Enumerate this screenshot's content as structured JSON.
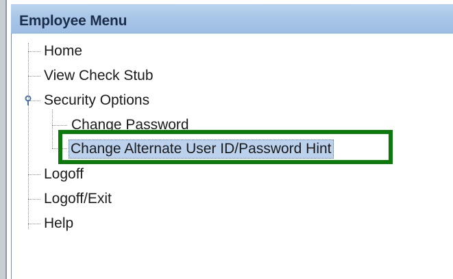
{
  "window": {
    "title": "Employee Menu"
  },
  "tree": {
    "items": [
      {
        "label": "Home"
      },
      {
        "label": "View Check Stub"
      },
      {
        "label": "Security Options",
        "expanded": true,
        "children": [
          {
            "label": "Change Password"
          },
          {
            "label": "Change Alternate User ID/Password Hint",
            "selected": true
          }
        ]
      },
      {
        "label": "Logoff"
      },
      {
        "label": "Logoff/Exit"
      },
      {
        "label": "Help"
      }
    ]
  },
  "colors": {
    "title_bar": "#a9c6e8",
    "title_text": "#1b2d4b",
    "selection_bg": "#bcd1ec",
    "annotation_box": "#0b7a0b",
    "handle_icon": "#4a6fa5"
  },
  "icons": {
    "expand_handle": "tree-expanded-handle-icon"
  }
}
